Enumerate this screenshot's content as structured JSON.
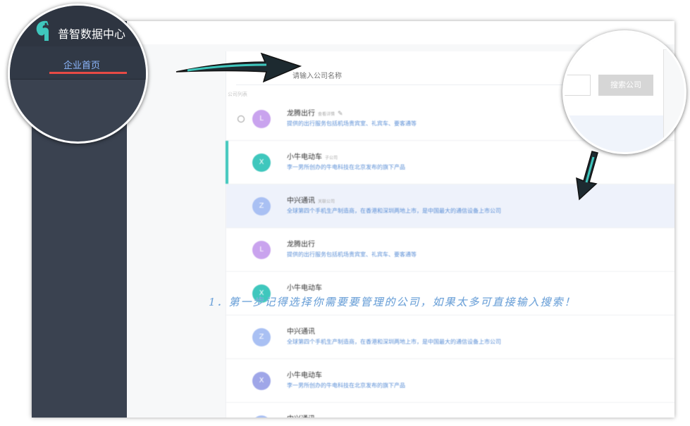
{
  "app": {
    "title": "普智数据中心",
    "nav_active": "企业首页"
  },
  "search": {
    "placeholder": "请输入公司名称",
    "button_label": "搜索公司"
  },
  "list": {
    "label": "公司列表",
    "rows": [
      {
        "avatar": "L",
        "name": "龙腾出行",
        "tag": "查看详情",
        "desc": "提供的出行服务包括机场贵宾室、礼宾车、要客通等",
        "color": "#c9a3ee"
      },
      {
        "avatar": "X",
        "name": "小牛电动车",
        "tag": "子公司",
        "desc": "李一男所创办的牛电科技在北京发布的旗下产品",
        "color": "#3fc7bd"
      },
      {
        "avatar": "Z",
        "name": "中兴通讯",
        "tag": "关联公司",
        "desc": "全球第四个手机生产制造商，在香港和深圳两地上市，是中国最大的通信设备上市公司",
        "color": "#a9c0f3"
      },
      {
        "avatar": "L",
        "name": "龙腾出行",
        "tag": "",
        "desc": "提供的出行服务包括机场贵宾室、礼宾车、要客通等",
        "color": "#c9a3ee"
      },
      {
        "avatar": "X",
        "name": "小牛电动车",
        "tag": "",
        "desc": "",
        "color": "#3fc7bd"
      },
      {
        "avatar": "Z",
        "name": "中兴通讯",
        "tag": "",
        "desc": "全球第四个手机生产制造商，在香港和深圳两地上市，是中国最大的通信设备上市公司",
        "color": "#a9c0f3"
      },
      {
        "avatar": "X",
        "name": "小牛电动车",
        "tag": "",
        "desc": "李一男所创办的牛电科技在北京发布的旗下产品",
        "color": "#9fa6e8"
      },
      {
        "avatar": "Z",
        "name": "中兴通讯",
        "tag": "",
        "desc": "",
        "color": "#a9c0f3"
      }
    ]
  },
  "instruction": "1．第一步记得选择你需要要管理的公司，如果太多可直接输入搜索！",
  "colors": {
    "sidebar": "#3a4250",
    "accent": "#3fc7bd",
    "nav_text": "#8db8ff",
    "underline": "#e74a45",
    "link": "#5b8fd6"
  }
}
